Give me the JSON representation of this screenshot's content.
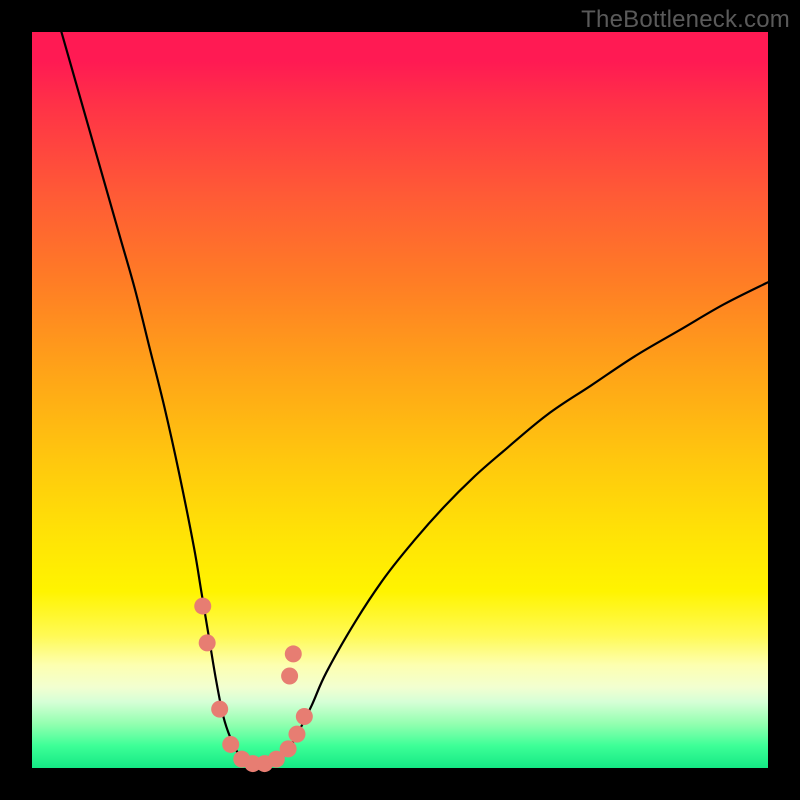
{
  "watermark": "TheBottleneck.com",
  "chart_data": {
    "type": "line",
    "title": "",
    "xlabel": "",
    "ylabel": "",
    "xlim": [
      0,
      100
    ],
    "ylim": [
      0,
      100
    ],
    "grid": false,
    "legend": false,
    "background_gradient": {
      "direction": "vertical",
      "stops": [
        {
          "pos": 0.0,
          "color": "#ff1a53"
        },
        {
          "pos": 0.1,
          "color": "#ff3247"
        },
        {
          "pos": 0.22,
          "color": "#ff5a36"
        },
        {
          "pos": 0.34,
          "color": "#ff7d25"
        },
        {
          "pos": 0.46,
          "color": "#ffa318"
        },
        {
          "pos": 0.58,
          "color": "#ffc70e"
        },
        {
          "pos": 0.68,
          "color": "#ffe206"
        },
        {
          "pos": 0.76,
          "color": "#fff400"
        },
        {
          "pos": 0.86,
          "color": "#fdffb0"
        },
        {
          "pos": 0.91,
          "color": "#d6ffd6"
        },
        {
          "pos": 0.97,
          "color": "#3dff97"
        },
        {
          "pos": 1.0,
          "color": "#14e884"
        }
      ]
    },
    "series": [
      {
        "name": "bottleneck-curve",
        "description": "V-shaped curve; steep left branch falling to a flat bottom then rising gently to the right.",
        "x": [
          4,
          6,
          8,
          10,
          12,
          14,
          16,
          18,
          20,
          22,
          23,
          24,
          25,
          26,
          27,
          28,
          29,
          30,
          31,
          32,
          33,
          34,
          35,
          36,
          38,
          40,
          44,
          48,
          52,
          56,
          60,
          64,
          70,
          76,
          82,
          88,
          94,
          100
        ],
        "y": [
          100,
          93,
          86,
          79,
          72,
          65,
          57,
          49,
          40,
          30,
          24,
          18,
          12,
          7,
          4,
          2,
          1,
          0.5,
          0.5,
          0.5,
          0.8,
          1.5,
          2.8,
          4.5,
          8.5,
          13,
          20,
          26,
          31,
          35.5,
          39.5,
          43,
          48,
          52,
          56,
          59.5,
          63,
          66
        ]
      }
    ],
    "markers": {
      "shape": "circle",
      "radius_px": 8.5,
      "color": "#e77d72",
      "points": [
        {
          "x": 23.2,
          "y": 22
        },
        {
          "x": 23.8,
          "y": 17
        },
        {
          "x": 25.5,
          "y": 8
        },
        {
          "x": 27.0,
          "y": 3.2
        },
        {
          "x": 28.5,
          "y": 1.2
        },
        {
          "x": 30.0,
          "y": 0.6
        },
        {
          "x": 31.6,
          "y": 0.6
        },
        {
          "x": 33.2,
          "y": 1.2
        },
        {
          "x": 34.8,
          "y": 2.6
        },
        {
          "x": 36.0,
          "y": 4.6
        },
        {
          "x": 37.0,
          "y": 7.0
        },
        {
          "x": 35.0,
          "y": 12.5
        },
        {
          "x": 35.5,
          "y": 15.5
        }
      ]
    }
  }
}
